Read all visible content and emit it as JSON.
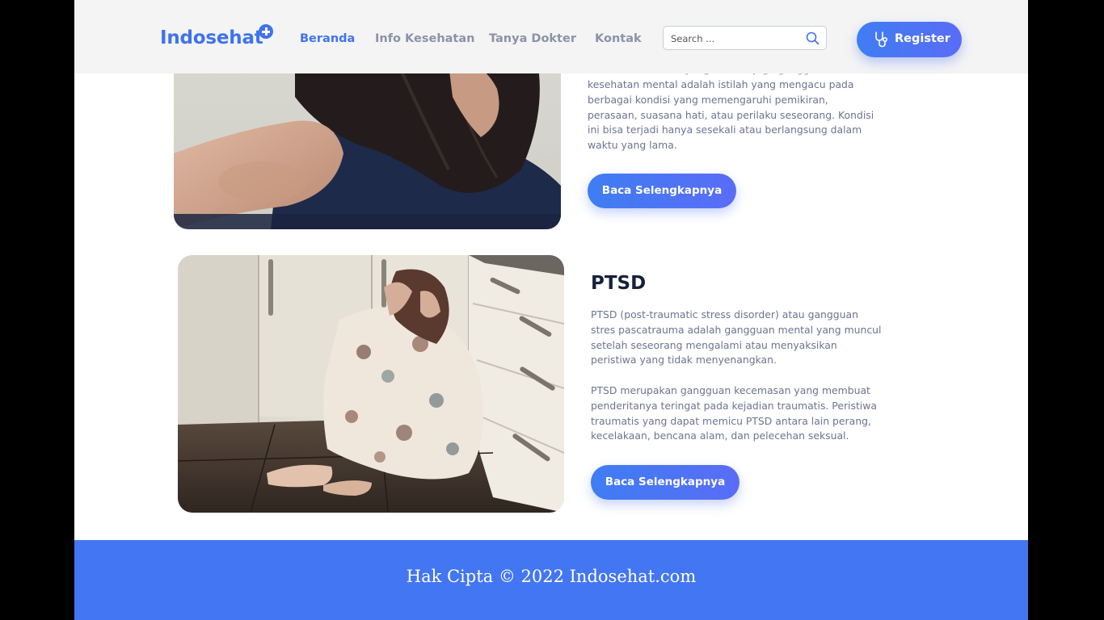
{
  "navbar": {
    "logo": "Indosehat",
    "links": [
      "Beranda",
      "Info Kesehatan",
      "Tanya Dokter",
      "Kontak"
    ],
    "active_link": "Beranda",
    "search_placeholder": "Search ...",
    "register_label": "Register"
  },
  "articles": [
    {
      "partial_intro": "Mental illness atau yang disebut juga gangguan",
      "lines": [
        "kesehatan mental adalah istilah yang mengacu pada",
        "berbagai kondisi yang memengaruhi pemikiran,",
        "perasaan, suasana hati, atau perilaku seseorang. Kondisi",
        "ini bisa terjadi hanya sesekali atau berlangsung dalam",
        "waktu yang lama."
      ],
      "button_label": "Baca Selengkapnya"
    },
    {
      "title": "PTSD",
      "paragraph1": [
        "PTSD (post-traumatic stress disorder) atau gangguan",
        "stres pascatrauma adalah gangguan mental yang muncul",
        "setelah seseorang mengalami atau menyaksikan",
        "peristiwa yang tidak menyenangkan."
      ],
      "paragraph2": [
        "PTSD merupakan gangguan kecemasan yang membuat",
        "penderitanya teringat pada kejadian traumatis. Peristiwa",
        "traumatis yang dapat memicu PTSD antara lain perang,",
        "kecelakaan, bencana alam, dan pelecehan seksual."
      ],
      "button_label": "Baca Selengkapnya"
    }
  ],
  "footer": {
    "copyright": "Hak Cipta © 2022 Indosehat.com"
  },
  "colors": {
    "brand": "#3f73ee",
    "footer_bg": "#4376f2",
    "nav_bg": "#f4f4f4",
    "text_muted": "#6c7590",
    "heading": "#16213a"
  }
}
